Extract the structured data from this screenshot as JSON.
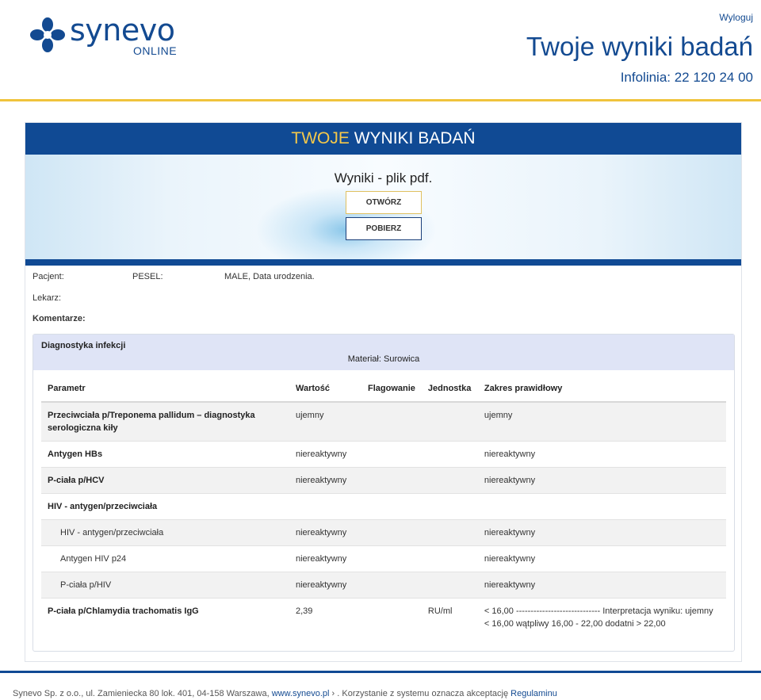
{
  "header": {
    "logo_text": "synevo",
    "logo_sub": "ONLINE",
    "logout_label": "Wyloguj",
    "title": "Twoje wyniki badań",
    "hotline": "Infolinia: 22 120 24 00",
    "brand_color": "#134a91",
    "accent_color": "#f0c33c"
  },
  "banner": {
    "title_highlight": "TWOJE",
    "title_rest": " WYNIKI BADAŃ",
    "pdf_label": "Wyniki - plik pdf.",
    "open_button": "OTWÓRZ",
    "download_button": "POBIERZ"
  },
  "patient": {
    "patient_label": "Pacjent:",
    "pesel_label": "PESEL:",
    "sex_birth": "MALE, Data urodzenia.",
    "doctor_label": "Lekarz:",
    "comments_label": "Komentarze:"
  },
  "results": {
    "section_title": "Diagnostyka infekcji",
    "material": "Materiał: Surowica",
    "columns": [
      "Parametr",
      "Wartość",
      "Flagowanie",
      "Jednostka",
      "Zakres prawidłowy"
    ],
    "rows": [
      {
        "param": "Przeciwciała p/Treponema pallidum – diagnostyka serologiczna kiły",
        "value": "ujemny",
        "flag": "",
        "unit": "",
        "range": "ujemny"
      },
      {
        "param": "Antygen HBs",
        "value": "niereaktywny",
        "flag": "",
        "unit": "",
        "range": "niereaktywny"
      },
      {
        "param": "P-ciała p/HCV",
        "value": "niereaktywny",
        "flag": "",
        "unit": "",
        "range": "niereaktywny"
      },
      {
        "param": "HIV - antygen/przeciwciała",
        "value": "",
        "flag": "",
        "unit": "",
        "range": ""
      },
      {
        "param": "HIV - antygen/przeciwciała",
        "value": "niereaktywny",
        "flag": "",
        "unit": "",
        "range": "niereaktywny"
      },
      {
        "param": "Antygen HIV p24",
        "value": "niereaktywny",
        "flag": "",
        "unit": "",
        "range": "niereaktywny"
      },
      {
        "param": "P-ciała p/HIV",
        "value": "niereaktywny",
        "flag": "",
        "unit": "",
        "range": "niereaktywny"
      },
      {
        "param": "P-ciała p/Chlamydia trachomatis IgG",
        "value": "2,39",
        "flag": "",
        "unit": "RU/ml",
        "range": "< 16,00 ----------------------------- Interpretacja wyniku: ujemny < 16,00 wątpliwy 16,00 - 22,00 dodatni > 22,00"
      }
    ]
  },
  "footer": {
    "text_before": "Synevo Sp. z o.o., ul. Zamieniecka 80 lok. 401, 04-158 Warszawa, ",
    "site_link": "www.synevo.pl",
    "arrow": " › ",
    "text_after": ". Korzystanie z systemu oznacza akceptację ",
    "terms_link": "Regulaminu"
  }
}
